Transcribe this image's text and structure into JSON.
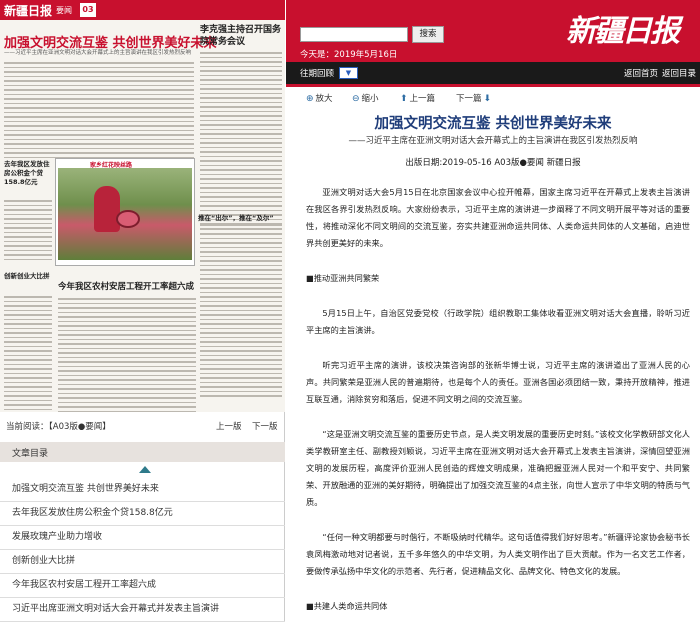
{
  "paper_page": {
    "masthead_logo": "新疆日报",
    "masthead_section": "要闻",
    "page_number": "03",
    "headline": "加强文明交流互鉴 共创世界美好未来",
    "subheadline": "——习近平主席在亚洲文明对话大会开幕式上的主旨演讲在我区引发热烈反响",
    "right_headline": "李克强主持召开国务院常务会议",
    "photo_caption": "家乡红花映丝路",
    "left_blurb_1": "去年我区发放住房公积金个贷158.8亿元",
    "left_blurb_2": "创新创业大比拼",
    "right_blurb": "推在“出尔”，推在“及尔”",
    "farm_headline": "今年我区农村安居工程开工率超六成"
  },
  "page_nav": {
    "current_label": "当前阅读：【A03版●要闻】",
    "prev_label": "上一版",
    "next_label": "下一版"
  },
  "toc": {
    "header": "文章目录",
    "items": [
      "加强文明交流互鉴 共创世界美好未来",
      "去年我区发放住房公积金个贷158.8亿元",
      "发展玫瑰产业助力增收",
      "创新创业大比拼",
      "今年我区农村安居工程开工率超六成",
      "习近平出席亚洲文明对话大会开幕式并发表主旨演讲"
    ]
  },
  "header": {
    "search_placeholder": "",
    "search_button": "搜索",
    "today": "今天是：2019年5月16日",
    "logo": "新疆日报",
    "past_label": "往期回顾",
    "past_select": "▼",
    "back_home": "返回首页",
    "back_dir": "返回目录"
  },
  "toolbar": {
    "zoom_in": "放大",
    "zoom_out": "缩小",
    "prev_article": "上一篇",
    "next_article": "下一篇"
  },
  "article": {
    "title": "加强文明交流互鉴 共创世界美好未来",
    "subtitle": "——习近平主席在亚洲文明对话大会开幕式上的主旨演讲在我区引发热烈反响",
    "meta": "出版日期:2019-05-16   A03版●要闻   新疆日报",
    "paragraphs": [
      "亚洲文明对话大会5月15日在北京国家会议中心拉开帷幕，国家主席习近平在开幕式上发表主旨演讲在我区各界引发热烈反响。大家纷纷表示，习近平主席的演讲进一步阐释了不同文明开展平等对话的重要性，将推动深化不同文明间的交流互鉴，夯实共建亚洲命运共同体、人类命运共同体的人文基础，启迪世界共创更美好的未来。",
      "■推动亚洲共同繁荣",
      "5月15日上午，自治区党委党校（行政学院）组织教职工集体收看亚洲文明对话大会直播，聆听习近平主席的主旨演讲。",
      "听完习近平主席的演讲，该校决策咨询部的张新华博士说，习近平主席的演讲道出了亚洲人民的心声。共同繁荣是亚洲人民的普遍期待，也是每个人的责任。亚洲各国必须团结一致，秉持开放精神，推进互联互通，消除贫穷和落后，促进不同文明之间的交流互鉴。",
      "“这是亚洲文明交流互鉴的重要历史节点，是人类文明发展的重要历史时刻。”该校文化学教研部文化人类学教研室主任、副教授刘颖说，习近平主席在亚洲文明对话大会开幕式上发表主旨演讲，深情回望亚洲文明的发展历程，高度评价亚洲人民创造的辉煌文明成果，准确把握亚洲人民对一个和平安宁、共同繁荣、开放融通的亚洲的美好期待，明确提出了加强交流互鉴的4点主张，向世人宣示了中华文明的特质与气质。",
      "“任何一种文明都要与时偕行，不断吸纳时代精华。这句话值得我们好好思考。”新疆评论家协会秘书长袁凤梅激动地对记者说，五千多年悠久的中华文明，为人类文明作出了巨大贡献。作为一名文艺工作者，要做传承弘扬中华文化的示范者、先行者，促进精品文化、品牌文化、特色文化的发展。",
      "■共建人类命运共同体"
    ]
  }
}
